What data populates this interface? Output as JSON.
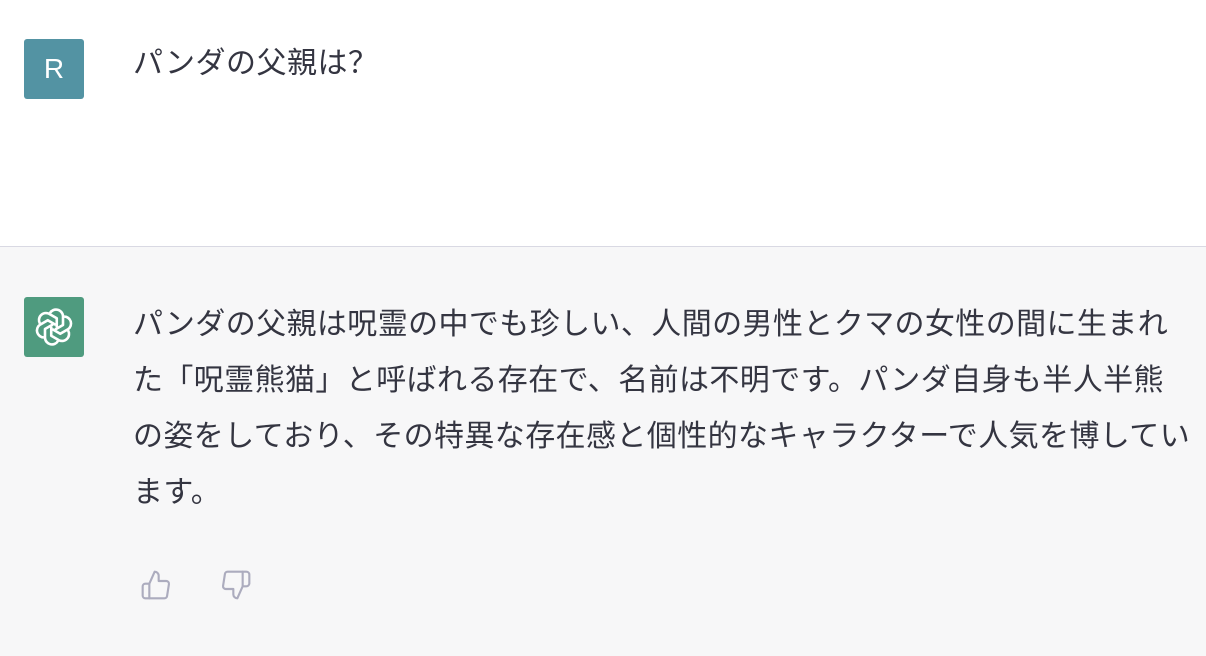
{
  "user": {
    "avatar_letter": "R",
    "avatar_color": "#5393a3",
    "message": "パンダの父親は？"
  },
  "assistant": {
    "avatar_icon": "openai-logo-icon",
    "avatar_color": "#4f9b7f",
    "message": "パンダの父親は呪霊の中でも珍しい、人間の男性とクマの女性の間に生まれた「呪霊熊猫」と呼ばれる存在で、名前は不明です。パンダ自身も半人半熊の姿をしており、その特異な存在感と個性的なキャラクターで人気を博しています。",
    "feedback": {
      "thumbs_up_icon": "thumbs-up-icon",
      "thumbs_down_icon": "thumbs-down-icon"
    }
  },
  "colors": {
    "user_row_bg": "#ffffff",
    "assistant_row_bg": "#f7f7f8",
    "text": "#343541",
    "icon_gray": "#acacbe"
  }
}
